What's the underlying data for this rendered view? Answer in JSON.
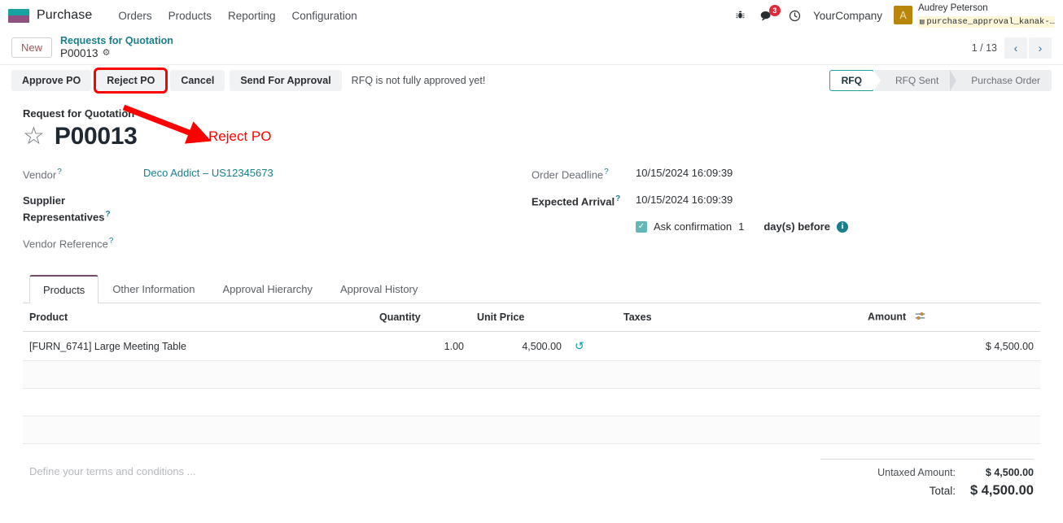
{
  "navbar": {
    "brand": "Purchase",
    "menus": [
      "Orders",
      "Products",
      "Reporting",
      "Configuration"
    ],
    "icons": {
      "bug": "bug-icon",
      "chat": "chat-icon",
      "clock": "clock-icon"
    },
    "chat_badge": "3",
    "company": "YourCompany",
    "user": {
      "initial": "A",
      "name": "Audrey Peterson",
      "database": "purchase_approval_kanak-…"
    }
  },
  "breadcrumb": {
    "new_label": "New",
    "parent": "Requests for Quotation",
    "current": "P00013"
  },
  "pager": {
    "text": "1 / 13",
    "prev": "‹",
    "next": "›"
  },
  "actions": {
    "buttons": [
      "Approve PO",
      "Reject PO",
      "Cancel",
      "Send For Approval"
    ],
    "note": "RFQ is not fully approved yet!",
    "highlighted": "Reject PO"
  },
  "statusbar": {
    "steps": [
      "RFQ",
      "RFQ Sent",
      "Purchase Order"
    ],
    "active": "RFQ"
  },
  "annotation": {
    "label": "Reject PO",
    "color": "#ff0000"
  },
  "form": {
    "title_label": "Request for Quotation",
    "record_name": "P00013",
    "left_fields": [
      {
        "label": "Vendor",
        "help": "?",
        "value": "Deco Addict – US12345673",
        "is_link": true,
        "required": false
      },
      {
        "label": "Supplier Representatives",
        "help": "?",
        "value": "",
        "is_link": false,
        "required": true
      },
      {
        "label": "Vendor Reference",
        "help": "?",
        "value": "",
        "is_link": false,
        "required": false
      }
    ],
    "right_fields": [
      {
        "label": "Order Deadline",
        "help": "?",
        "value": "10/15/2024 16:09:39",
        "required": false
      },
      {
        "label": "Expected Arrival",
        "help": "?",
        "value": "10/15/2024 16:09:39",
        "required": true
      }
    ],
    "reminder": {
      "checked": true,
      "check_glyph": "✓",
      "text_before": "Ask confirmation",
      "days": "1",
      "text_after": "day(s) before",
      "info_glyph": "i"
    }
  },
  "notebook": {
    "tabs": [
      "Products",
      "Other Information",
      "Approval Hierarchy",
      "Approval History"
    ],
    "active_tab": "Products"
  },
  "lines_table": {
    "headers": [
      "Product",
      "Quantity",
      "Unit Price",
      "Taxes",
      "Amount"
    ],
    "optional_columns_icon": "sliders-icon",
    "rows": [
      {
        "product": "[FURN_6741] Large Meeting Table",
        "quantity": "1.00",
        "unit_price": "4,500.00",
        "reset_icon": "reset-price-icon",
        "taxes": "",
        "amount": "$ 4,500.00"
      }
    ],
    "empty_rows": 3
  },
  "footer": {
    "terms_placeholder": "Define your terms and conditions ...",
    "totals": [
      {
        "label": "Untaxed Amount:",
        "value": "$ 4,500.00"
      },
      {
        "label": "Total:",
        "value": "$ 4,500.00"
      }
    ]
  },
  "colors": {
    "brand_teal": "#17a2a2",
    "brand_purple": "#714b67",
    "link": "#1a7e8c",
    "annotation_red": "#ff0000",
    "badge_red": "#e0293b",
    "avatar": "#b8860b"
  }
}
